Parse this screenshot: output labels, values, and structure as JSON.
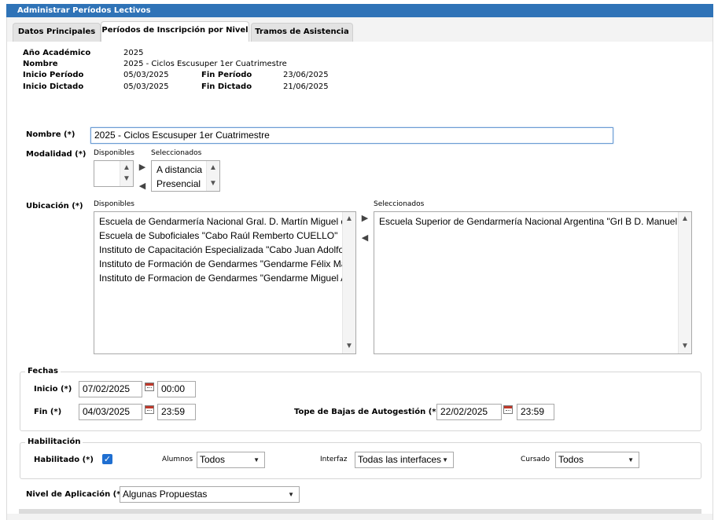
{
  "window": {
    "title": "Administrar Períodos Lectivos"
  },
  "tabs": [
    {
      "label": "Datos Principales"
    },
    {
      "label": "Períodos de Inscripción por Nivel"
    },
    {
      "label": "Tramos de Asistencia"
    }
  ],
  "info": {
    "anio_label": "Año Académico",
    "anio_value": "2025",
    "nombre_label": "Nombre",
    "nombre_value": "2025 - Ciclos Escusuper 1er Cuatrimestre",
    "inicio_periodo_label": "Inicio Período",
    "inicio_periodo_value": "05/03/2025",
    "fin_periodo_label": "Fin Período",
    "fin_periodo_value": "23/06/2025",
    "inicio_dictado_label": "Inicio Dictado",
    "inicio_dictado_value": "05/03/2025",
    "fin_dictado_label": "Fin Dictado",
    "fin_dictado_value": "21/06/2025"
  },
  "form": {
    "nombre_label": "Nombre (*)",
    "nombre_value": "2025 - Ciclos Escusuper 1er Cuatrimestre",
    "modalidad_label": "Modalidad (*)",
    "modalidad_disponibles_label": "Disponibles",
    "modalidad_seleccionados_label": "Seleccionados",
    "modalidad_disponibles": [],
    "modalidad_seleccionados": [
      "A distancia",
      "Presencial"
    ],
    "ubicacion_label": "Ubicación (*)",
    "ubicacion_disponibles_label": "Disponibles",
    "ubicacion_seleccionados_label": "Seleccionados",
    "ubicacion_disponibles": [
      "Escuela de Gendarmería Nacional Gral. D. Martín Miguel de",
      "Escuela de Suboficiales \"Cabo Raúl Remberto CUELLO\"",
      "Instituto de Capacitación Especializada \"Cabo Juan Adolfo I",
      "Instituto de Formación de Gendarmes \"Gendarme Félix Mar",
      "Instituto de Formacion de Gendarmes \"Gendarme Miguel Ar"
    ],
    "ubicacion_seleccionados": [
      "Escuela Superior de Gendarmería Nacional Argentina \"Grl B D. Manuel M"
    ]
  },
  "fechas": {
    "legend": "Fechas",
    "inicio_label": "Inicio (*)",
    "inicio_date": "07/02/2025",
    "inicio_time": "00:00",
    "fin_label": "Fin (*)",
    "fin_date": "04/03/2025",
    "fin_time": "23:59",
    "tope_label": "Tope de Bajas de Autogestión (*)",
    "tope_date": "22/02/2025",
    "tope_time": "23:59"
  },
  "habilitacion": {
    "legend": "Habilitación",
    "habilitado_label": "Habilitado (*)",
    "alumnos_label": "Alumnos",
    "alumnos_value": "Todos",
    "interfaz_label": "Interfaz",
    "interfaz_value": "Todas las interfaces",
    "cursado_label": "Cursado",
    "cursado_value": "Todos"
  },
  "nivel": {
    "label": "Nivel de Aplicación (*)",
    "value": "Algunas Propuestas"
  },
  "icons": {
    "move_right": "▶",
    "move_left": "◀",
    "scroll_up": "▲",
    "scroll_down": "▼",
    "caret": "▼",
    "check": "✓"
  },
  "colors": {
    "titlebar": "#2f73b7",
    "checkbox": "#1f6fd1",
    "focus_border": "#6b9bd3"
  }
}
